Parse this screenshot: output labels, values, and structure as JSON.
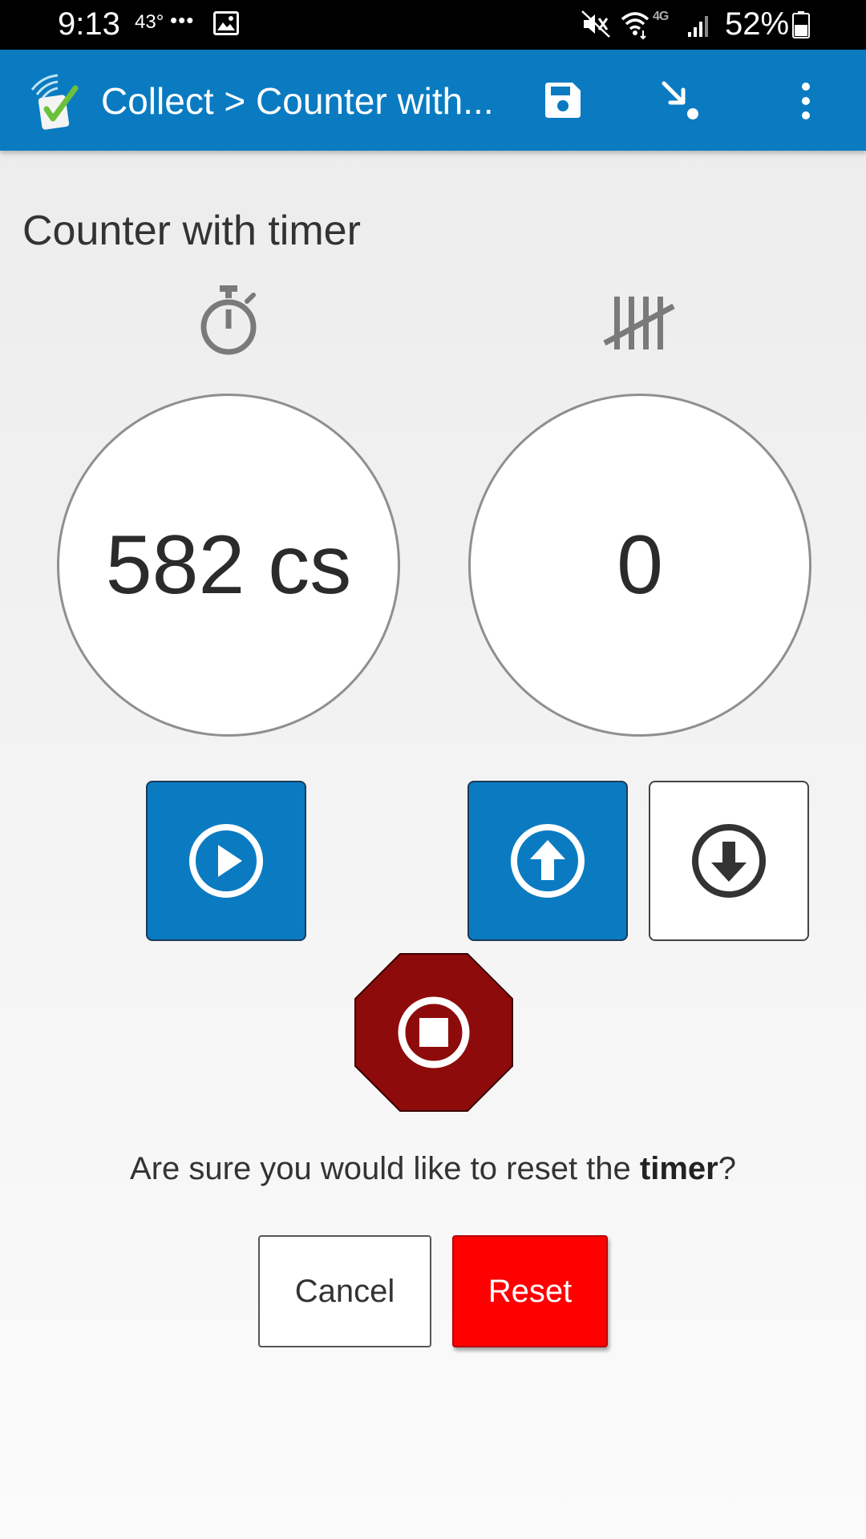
{
  "status_bar": {
    "time": "9:13",
    "temperature": "43°",
    "more_indicator": "•••",
    "network_label": "4G",
    "battery_percent": "52%",
    "icons": [
      "gallery-icon",
      "mute-icon",
      "wifi-icon",
      "signal-icon",
      "battery-icon"
    ]
  },
  "app_bar": {
    "title": "Collect > Counter with...",
    "icons": [
      "odk-collect-logo",
      "save-icon",
      "jump-icon",
      "overflow-menu-icon"
    ]
  },
  "question": {
    "label": "Counter with timer"
  },
  "timer": {
    "value": "582 cs",
    "icon": "stopwatch-icon"
  },
  "counter": {
    "value": "0",
    "icon": "tally-icon"
  },
  "controls": {
    "play_icon": "play-circle-icon",
    "increment_icon": "arrow-up-circle-icon",
    "decrement_icon": "arrow-down-circle-icon",
    "stop_icon": "stop-circle-icon"
  },
  "reset_dialog": {
    "prompt_before": "Are sure you would like to reset the ",
    "prompt_emphasis": "timer",
    "prompt_after": "?",
    "cancel_label": "Cancel",
    "reset_label": "Reset"
  },
  "colors": {
    "primary_blue": "#0a7bc1",
    "stop_red": "#8e0b0b",
    "reset_red": "#ff0000"
  }
}
